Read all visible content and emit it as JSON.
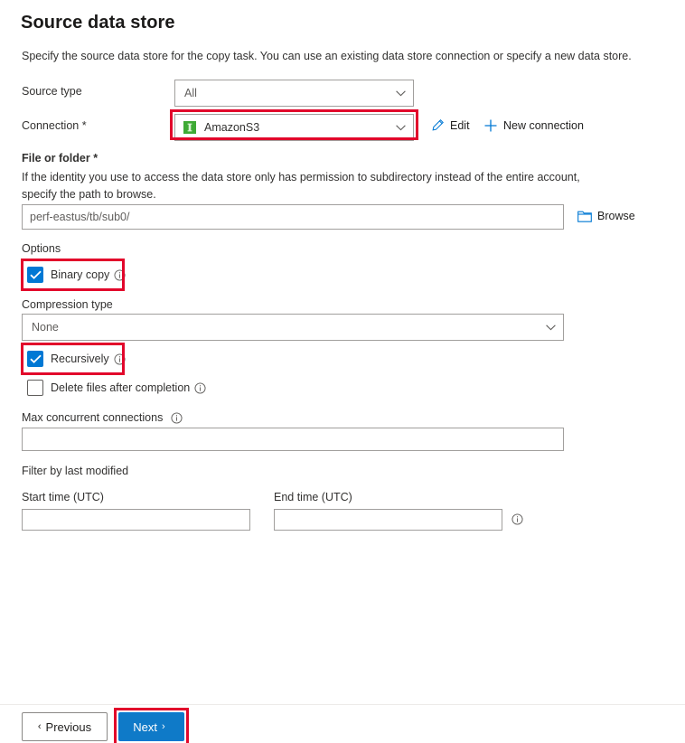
{
  "page": {
    "title": "Source data store",
    "subtitle": "Specify the source data store for the copy task. You can use an existing data store connection or specify a new data store.",
    "accent_blue": "#0078d4",
    "highlight_red": "#e2072b",
    "required_red": "#a4262c"
  },
  "source_type": {
    "label": "Source type",
    "value": "All",
    "chevron_icon": "chevron-down-icon"
  },
  "connection": {
    "label": "Connection",
    "required_marker": "*",
    "value": "AmazonS3",
    "icon": "amazon-s3-icon",
    "icon_color": "#3eaa35",
    "chevron_icon": "chevron-down-icon",
    "edit_label": "Edit",
    "edit_icon": "pencil-icon",
    "new_connection_label": "New connection",
    "new_connection_icon": "plus-icon",
    "highlighted": true
  },
  "file_or_folder": {
    "label": "File or folder",
    "required_marker": "*",
    "help": "If the identity you use to access the data store only has permission to subdirectory instead of the entire account, specify the path to browse.",
    "value": "perf-eastus/tb/sub0/",
    "browse_label": "Browse",
    "browse_icon": "folder-icon"
  },
  "options": {
    "label": "Options",
    "binary_copy": {
      "label": "Binary copy",
      "checked": true,
      "info_icon": "info-icon",
      "highlighted": true
    },
    "compression_type": {
      "label": "Compression type",
      "value": "None",
      "chevron_icon": "chevron-down-icon"
    },
    "recursively": {
      "label": "Recursively",
      "checked": true,
      "info_icon": "info-icon",
      "highlighted": true
    },
    "delete_files": {
      "label": "Delete files after completion",
      "checked": false,
      "info_icon": "info-icon"
    },
    "max_concurrent_connections": {
      "label": "Max concurrent connections",
      "value": "",
      "info_icon": "info-icon"
    }
  },
  "filter": {
    "label": "Filter by last modified",
    "start_time_label": "Start time (UTC)",
    "start_time_value": "",
    "end_time_label": "End time (UTC)",
    "end_time_value": "",
    "info_icon": "info-icon"
  },
  "footer": {
    "previous_label": "Previous",
    "previous_glyph": "‹",
    "next_label": "Next",
    "next_glyph": "›",
    "next_highlighted": true
  }
}
